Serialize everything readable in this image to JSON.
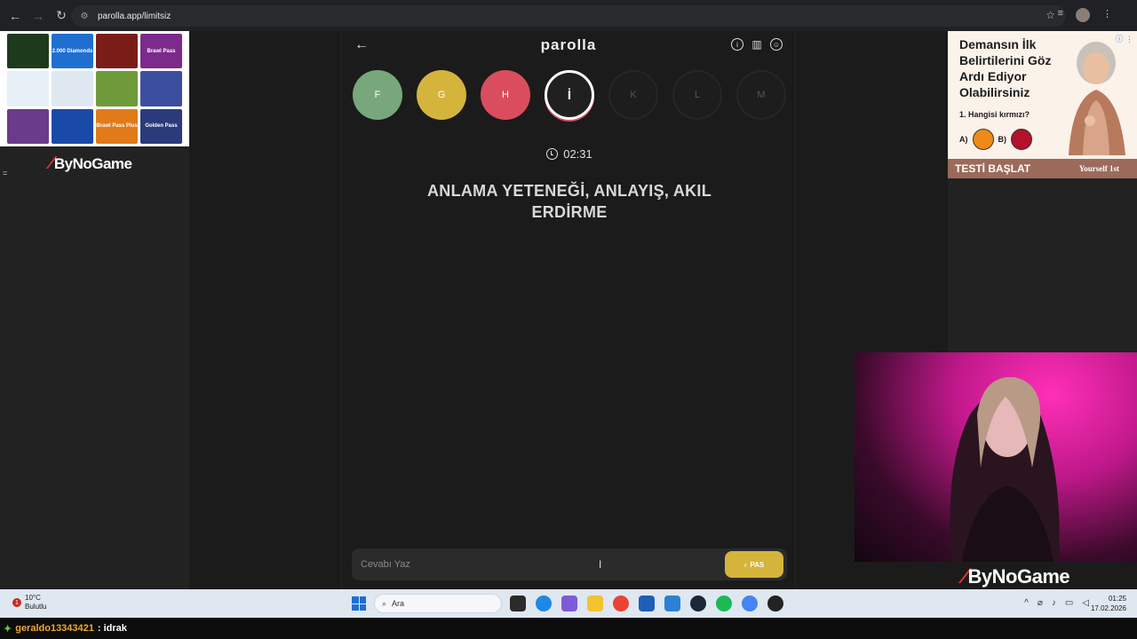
{
  "browser": {
    "url": "parolla.app/limitsiz"
  },
  "left_ad": {
    "tiles": [
      {
        "label": "",
        "color": "#1d3b1c"
      },
      {
        "label": "2.000 Diamonds",
        "color": "#1f6fd1"
      },
      {
        "label": "",
        "color": "#7a1d18"
      },
      {
        "label": "Brawl Pass",
        "color": "#7c2a8c"
      },
      {
        "label": "",
        "color": "#e6eef6"
      },
      {
        "label": "",
        "color": "#dfe8f0"
      },
      {
        "label": "",
        "color": "#6f9a3a"
      },
      {
        "label": "",
        "color": "#3b4fa0"
      },
      {
        "label": "",
        "color": "#6a3b8a"
      },
      {
        "label": "",
        "color": "#1a4aa8"
      },
      {
        "label": "Brawl Pass Plus",
        "color": "#e07a1a"
      },
      {
        "label": "Golden Pass",
        "color": "#2a3a7a"
      }
    ],
    "brand": "ByNoGame",
    "marker": "="
  },
  "game": {
    "title": "parolla",
    "letters": [
      {
        "char": "F",
        "state": "done-green"
      },
      {
        "char": "G",
        "state": "done-yellow"
      },
      {
        "char": "H",
        "state": "done-red"
      },
      {
        "char": "İ",
        "state": "active"
      },
      {
        "char": "K",
        "state": "pending"
      },
      {
        "char": "L",
        "state": "pending"
      },
      {
        "char": "M",
        "state": "pending"
      }
    ],
    "timer": "02:31",
    "question": "ANLAMA YETENEĞİ, ANLAYIŞ, AKIL ERDİRME",
    "answer_placeholder": "Cevabı Yaz",
    "pass_label": "PAS"
  },
  "right_ad": {
    "headline": "Demansın İlk Belirtilerini Göz Ardı Ediyor Olabilirsiniz",
    "question": "1. Hangisi kırmızı?",
    "option_a": "A)",
    "option_b": "B)",
    "option_a_color": "#f08a17",
    "option_b_color": "#b5102c",
    "cta": "TESTİ BAŞLAT",
    "brand_small": "Yourself 1st"
  },
  "webcam_brand": "ByNoGame",
  "taskbar": {
    "temperature": "10°C",
    "weather": "Bulutlu",
    "notification_count": "1",
    "search_placeholder": "Ara",
    "time": "01:25",
    "date": "17.02.2026"
  },
  "chat": {
    "username": "geraldo13343421",
    "message": ": idrak"
  }
}
